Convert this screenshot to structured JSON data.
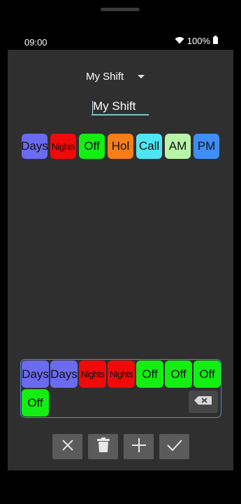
{
  "status": {
    "time": "09:00",
    "battery": "100%"
  },
  "shift_selector": {
    "value": "My Shift"
  },
  "name_field": {
    "value": "My Shift"
  },
  "palette": [
    {
      "label": "Days",
      "color": "#6b6bf0",
      "condensed": false
    },
    {
      "label": "Nights",
      "color": "#f00a0a",
      "condensed": true
    },
    {
      "label": "Off",
      "color": "#13ee13",
      "condensed": false
    },
    {
      "label": "Hol",
      "color": "#f57d1a",
      "condensed": false
    },
    {
      "label": "Call",
      "color": "#4ee6f2",
      "condensed": false
    },
    {
      "label": "AM",
      "color": "#b8f5a8",
      "condensed": false
    },
    {
      "label": "PM",
      "color": "#3f8ef5",
      "condensed": false
    },
    {
      "label": "",
      "color": "#ec1aa8",
      "condensed": false
    }
  ],
  "sequence": [
    {
      "label": "Days",
      "color": "#6b6bf0",
      "condensed": false
    },
    {
      "label": "Days",
      "color": "#6b6bf0",
      "condensed": false
    },
    {
      "label": "Nights",
      "color": "#f00a0a",
      "condensed": true
    },
    {
      "label": "Nights",
      "color": "#f00a0a",
      "condensed": true
    },
    {
      "label": "Off",
      "color": "#13ee13",
      "condensed": false
    },
    {
      "label": "Off",
      "color": "#13ee13",
      "condensed": false
    },
    {
      "label": "Off",
      "color": "#13ee13",
      "condensed": false
    },
    {
      "label": "Off",
      "color": "#13ee13",
      "condensed": false
    }
  ],
  "icons": {
    "backspace": "backspace-icon",
    "cancel": "close-icon",
    "delete": "trash-icon",
    "add": "plus-icon",
    "confirm": "check-icon"
  }
}
